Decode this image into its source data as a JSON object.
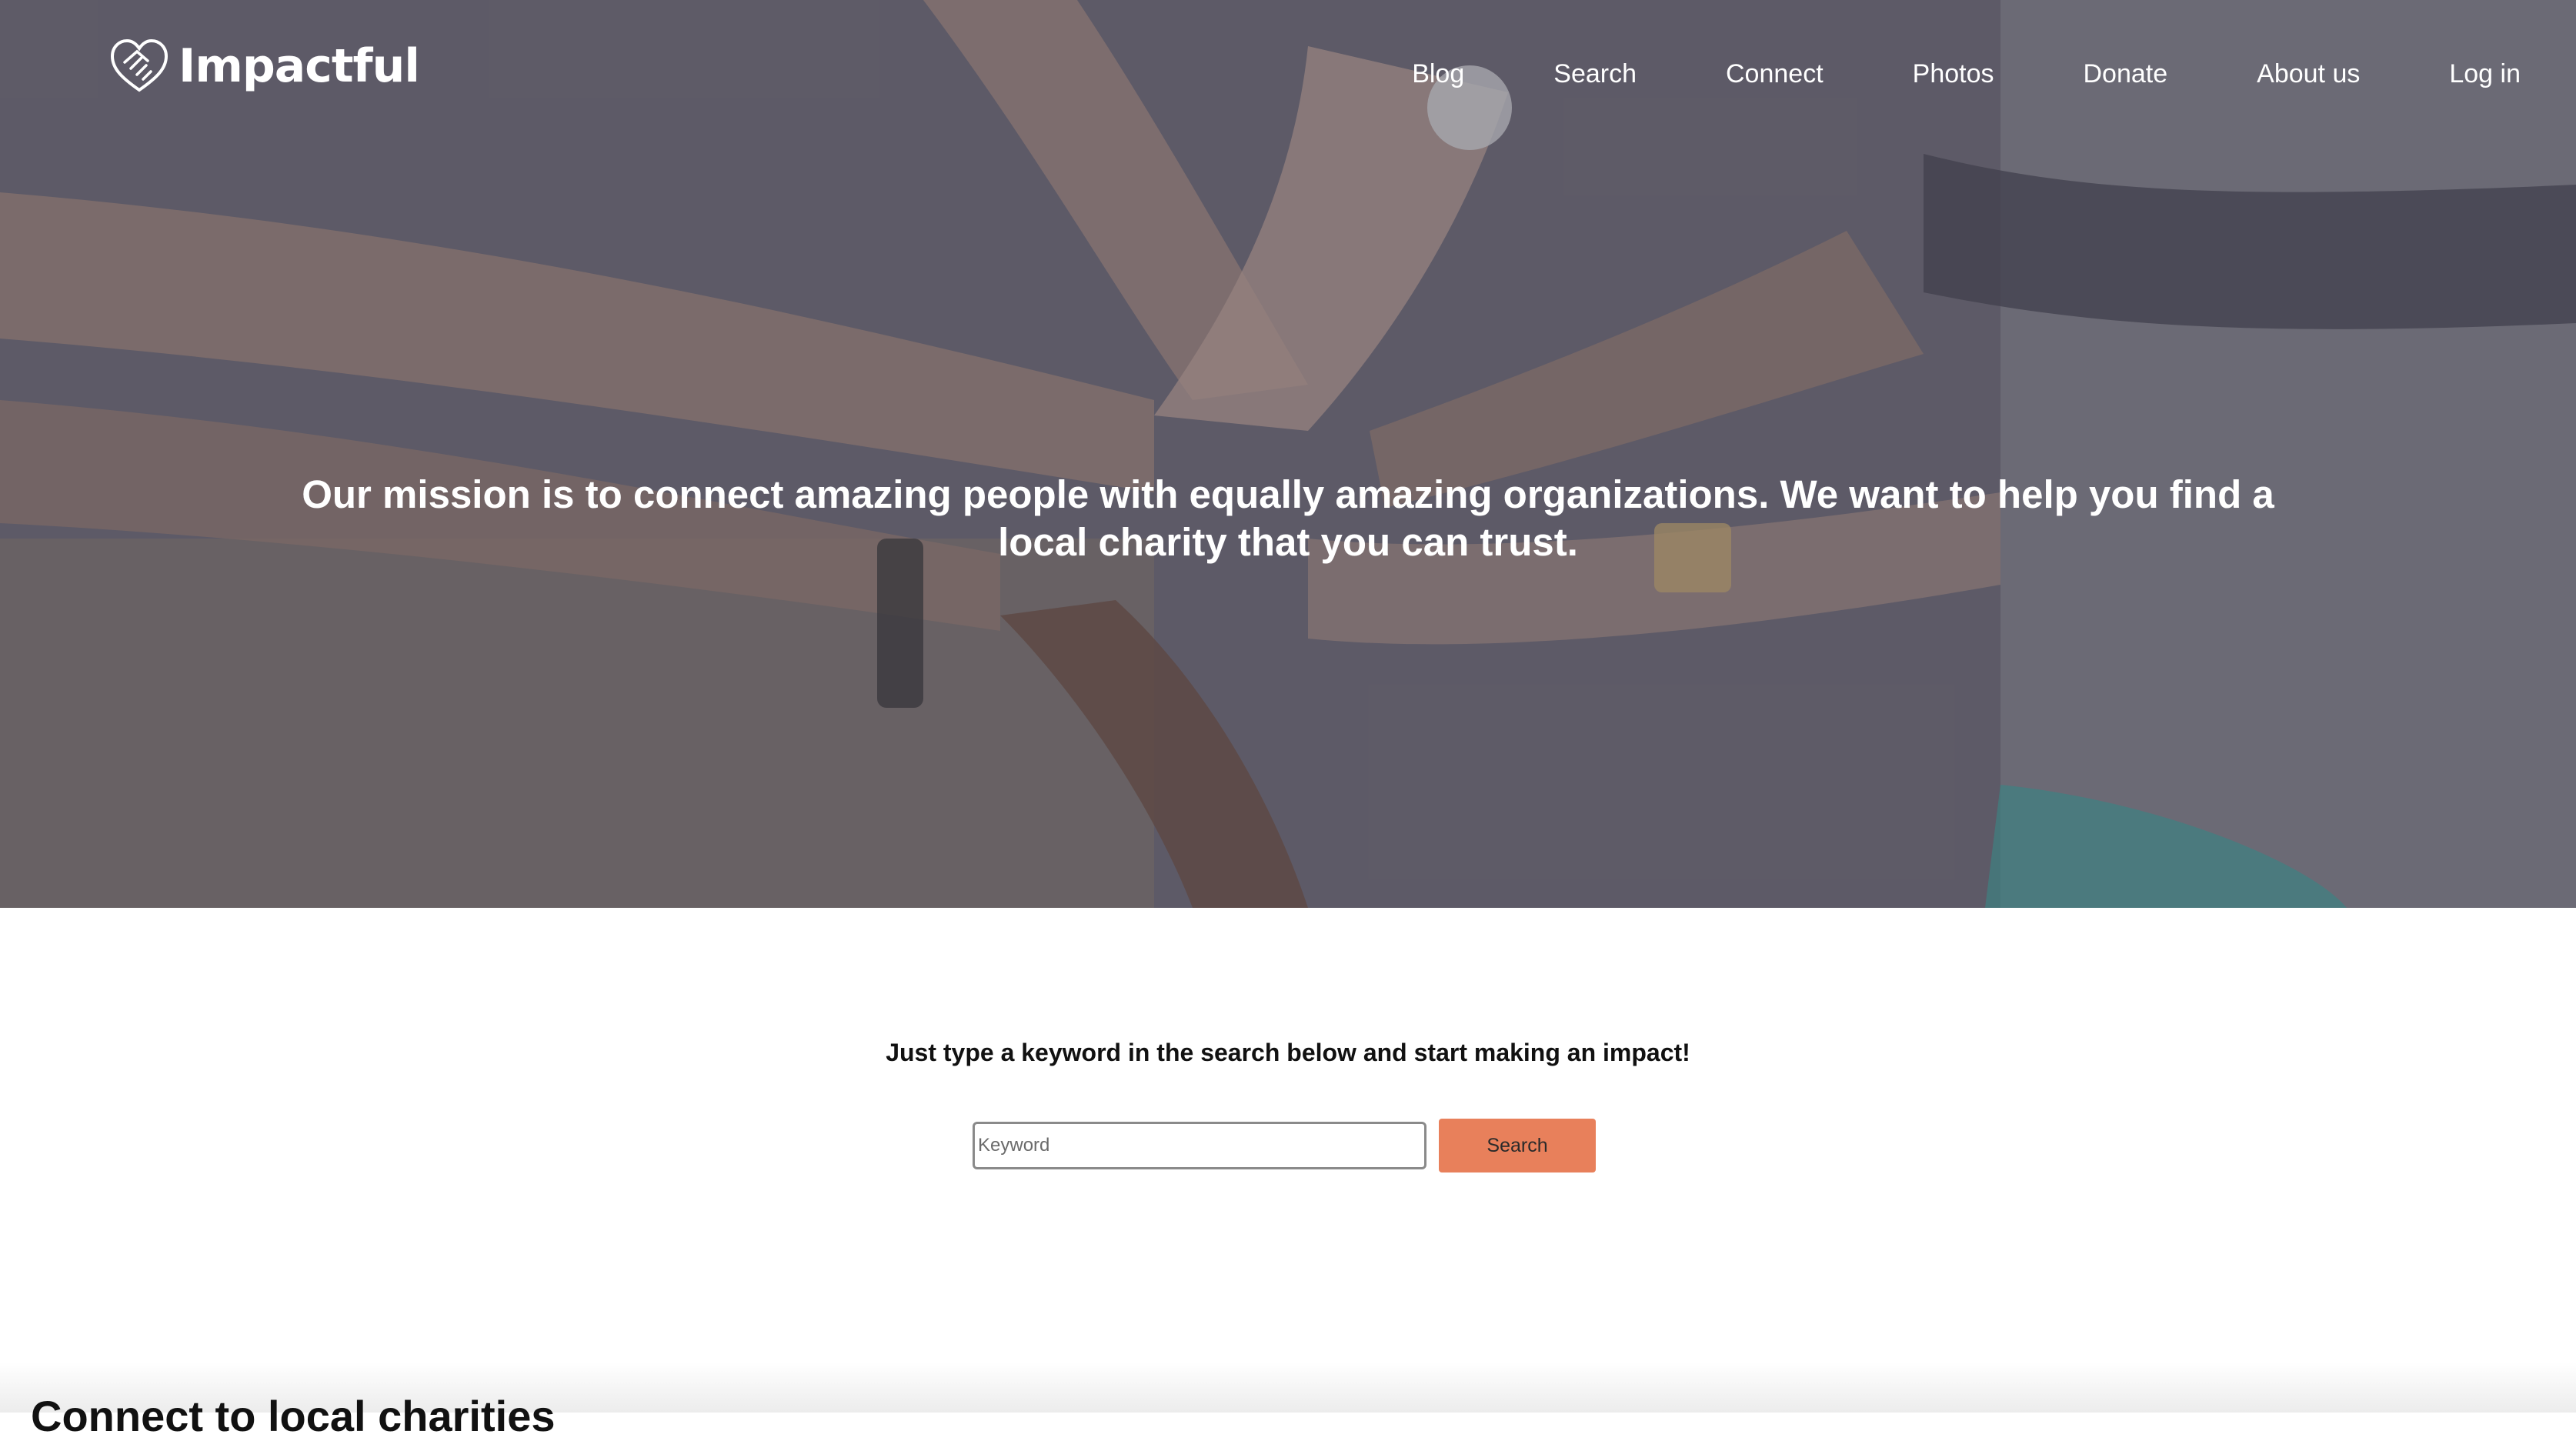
{
  "brand": {
    "name": "Impactful",
    "icon": "handshake-heart-icon"
  },
  "nav": {
    "items": [
      {
        "label": "Blog"
      },
      {
        "label": "Search"
      },
      {
        "label": "Connect"
      },
      {
        "label": "Photos"
      },
      {
        "label": "Donate"
      },
      {
        "label": "About us"
      },
      {
        "label": "Log in"
      }
    ]
  },
  "hero": {
    "mission": "Our mission is to connect amazing people with equally amazing organizations. We want to help you find a local charity that you can trust.",
    "image": "stacked-hands-photo"
  },
  "search": {
    "prompt": "Just type a keyword in the search below and start making an impact!",
    "placeholder": "Keyword",
    "value": "",
    "button_label": "Search"
  },
  "next_section": {
    "title": "Connect to local charities"
  },
  "colors": {
    "accent": "#e8805b",
    "hero_overlay": "#5b5a63",
    "text_light": "#ffffff"
  }
}
